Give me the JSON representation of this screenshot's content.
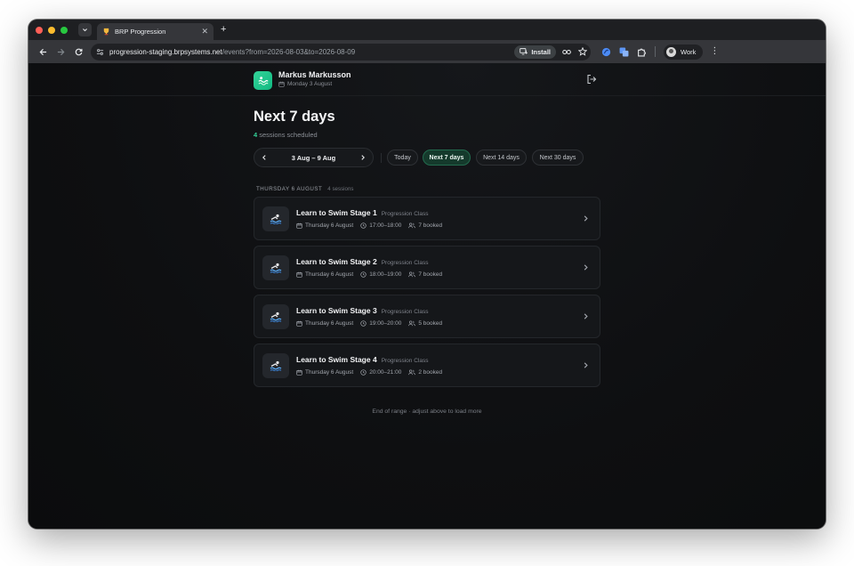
{
  "browser": {
    "tab_title": "BRP Progression",
    "url_host": "progression-staging.brpsystems.net",
    "url_path": "/events?from=2026-08-03&to=2026-08-09",
    "install_label": "Install",
    "profile_label": "Work"
  },
  "header": {
    "user_name": "Markus Markusson",
    "user_date": "Monday 3 August"
  },
  "main": {
    "title": "Next 7 days",
    "session_count": "4",
    "session_count_suffix": "sessions scheduled",
    "range_label": "3 Aug – 9 Aug",
    "filters": [
      {
        "label": "Today",
        "active": false
      },
      {
        "label": "Next 7 days",
        "active": true
      },
      {
        "label": "Next 14 days",
        "active": false
      },
      {
        "label": "Next 30 days",
        "active": false
      }
    ],
    "day_group": {
      "title": "THURSDAY 6 AUGUST",
      "count_label": "4 sessions"
    },
    "sessions": [
      {
        "name": "Learn to Swim Stage 1",
        "type": "Progression Class",
        "date": "Thursday 6 August",
        "time": "17:00–18:00",
        "booked": "7 booked"
      },
      {
        "name": "Learn to Swim Stage 2",
        "type": "Progression Class",
        "date": "Thursday 6 August",
        "time": "18:00–19:00",
        "booked": "7 booked"
      },
      {
        "name": "Learn to Swim Stage 3",
        "type": "Progression Class",
        "date": "Thursday 6 August",
        "time": "19:00–20:00",
        "booked": "5 booked"
      },
      {
        "name": "Learn to Swim Stage 4",
        "type": "Progression Class",
        "date": "Thursday 6 August",
        "time": "20:00–21:00",
        "booked": "2 booked"
      }
    ],
    "footer": "End of range · adjust above to load more"
  },
  "icons": {
    "logo": "wave-icon",
    "session": "swimmer-wave-icon",
    "logout": "logout-icon"
  },
  "colors": {
    "accent": "#34d399",
    "active_chip_bg": "#153a2c",
    "page_bg": "#0e0f11"
  }
}
